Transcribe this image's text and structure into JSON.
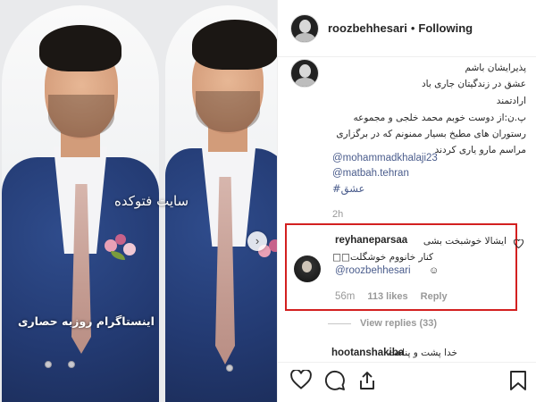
{
  "photo": {
    "watermark_top": "سایت فتوکده",
    "watermark_bottom": "اینستاگرام روزبه حصاری",
    "next_arrow": "›"
  },
  "header": {
    "username": "roozbehhesari",
    "separator": "•",
    "follow_state": "Following"
  },
  "caption": {
    "lines": [
      "پذیرایشان باشم",
      "عشق در زندگیتان جاری باد",
      "ارادتمند",
      "پ.ن:از دوست خوبم محمد خلجی و مجموعه",
      "رستوران های مطبخ بسیار ممنونم که در برگزاری",
      "مراسم مارو یاری کردند"
    ],
    "mention1": "@mohammadkhalaji23",
    "mention2": "@matbah.tehran",
    "hashtag": "#عشق",
    "time": "2h"
  },
  "comment": {
    "username": "reyhaneparsaa",
    "text_line1": "ایشالا خوشبخت بشی",
    "text_line2": "کنار خانووم خوشگلت□□",
    "mention": "@roozbehhesari",
    "emoji": "☺",
    "time": "56m",
    "likes": "113 likes",
    "reply": "Reply"
  },
  "view_replies": "View replies (33)",
  "next_comment": {
    "username": "hootanshakiba",
    "text": "خدا پشت و پناهت"
  },
  "icons": [
    "heart-icon",
    "comment-icon",
    "share-icon",
    "bookmark-icon",
    "chevron-right-icon",
    "heart-outline-icon"
  ],
  "colors": {
    "highlight_border": "#d32020",
    "link": "#4a5c8c",
    "muted": "#999999"
  }
}
